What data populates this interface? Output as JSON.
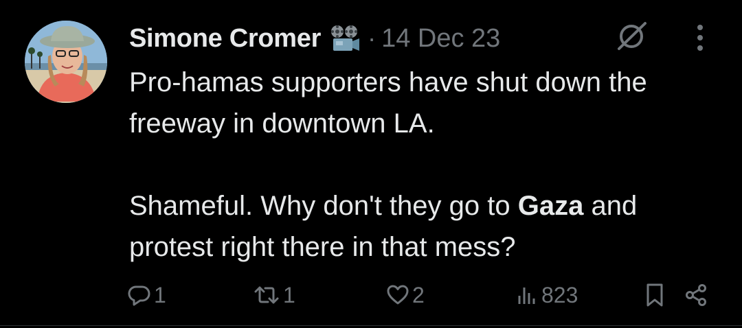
{
  "tweet": {
    "author_name": "Simone Cromer",
    "badge_icon": "film-camera-icon",
    "separator": "·",
    "date": "14 Dec 23",
    "grok_icon": "grok-icon",
    "more_icon": "more-vertical-icon",
    "text": {
      "line1": "Pro-hamas supporters have shut down the freeway in downtown LA.",
      "line2_before": "Shameful. Why don't they go to ",
      "line2_bold": "Gaza",
      "line2_after": " and protest right there in that mess?"
    }
  },
  "actions": {
    "reply": {
      "icon": "reply-icon",
      "count": "1"
    },
    "repost": {
      "icon": "repost-icon",
      "count": "1"
    },
    "like": {
      "icon": "heart-icon",
      "count": "2"
    },
    "views": {
      "icon": "views-icon",
      "count": "823"
    },
    "bookmark": {
      "icon": "bookmark-icon"
    },
    "share": {
      "icon": "share-icon"
    }
  },
  "colors": {
    "background": "#000000",
    "text_primary": "#e7e9ea",
    "text_secondary": "#71767b"
  }
}
